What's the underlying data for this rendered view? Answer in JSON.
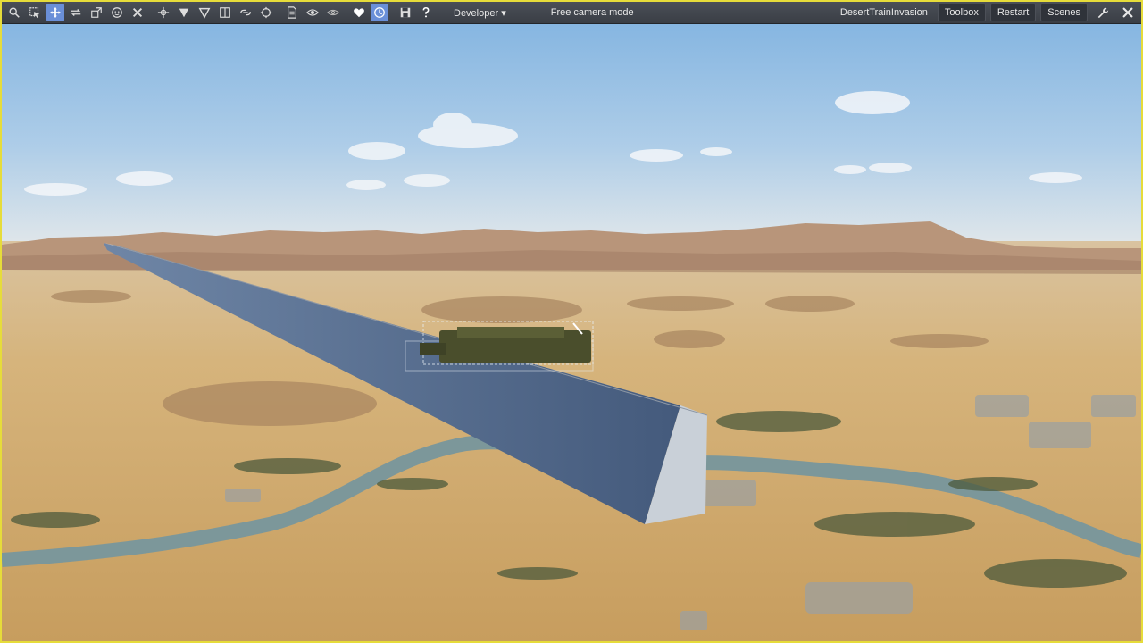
{
  "toolbar": {
    "left_tools": [
      {
        "name": "search-icon",
        "active": false
      },
      {
        "name": "select-icon",
        "active": false
      },
      {
        "name": "move-icon",
        "active": true
      },
      {
        "name": "rotate-icon",
        "active": false
      },
      {
        "name": "scale-icon",
        "active": false
      },
      {
        "name": "face-icon",
        "active": false
      },
      {
        "name": "close-x-icon",
        "active": false
      },
      {
        "name": "snap-icon",
        "active": false
      },
      {
        "name": "triangle-down-icon",
        "active": false
      },
      {
        "name": "triangle-outline-icon",
        "active": false
      },
      {
        "name": "columns-icon",
        "active": false
      },
      {
        "name": "link-icon",
        "active": false
      },
      {
        "name": "crosshair-icon",
        "active": false
      },
      {
        "name": "document-icon",
        "active": false
      },
      {
        "name": "eye-icon",
        "active": false
      },
      {
        "name": "eye-alt-icon",
        "active": false
      },
      {
        "name": "heart-icon",
        "active": false
      },
      {
        "name": "clock-icon",
        "active": true
      },
      {
        "name": "save-icon",
        "active": false
      },
      {
        "name": "help-icon",
        "active": false
      }
    ],
    "developer_label": "Developer ▾",
    "camera_mode": "Free camera mode",
    "scene_name": "DesertTrainInvasion",
    "toolbox_label": "Toolbox",
    "restart_label": "Restart",
    "scenes_label": "Scenes",
    "border_color": "#e6dc3a",
    "active_color": "#6a8fd8"
  }
}
